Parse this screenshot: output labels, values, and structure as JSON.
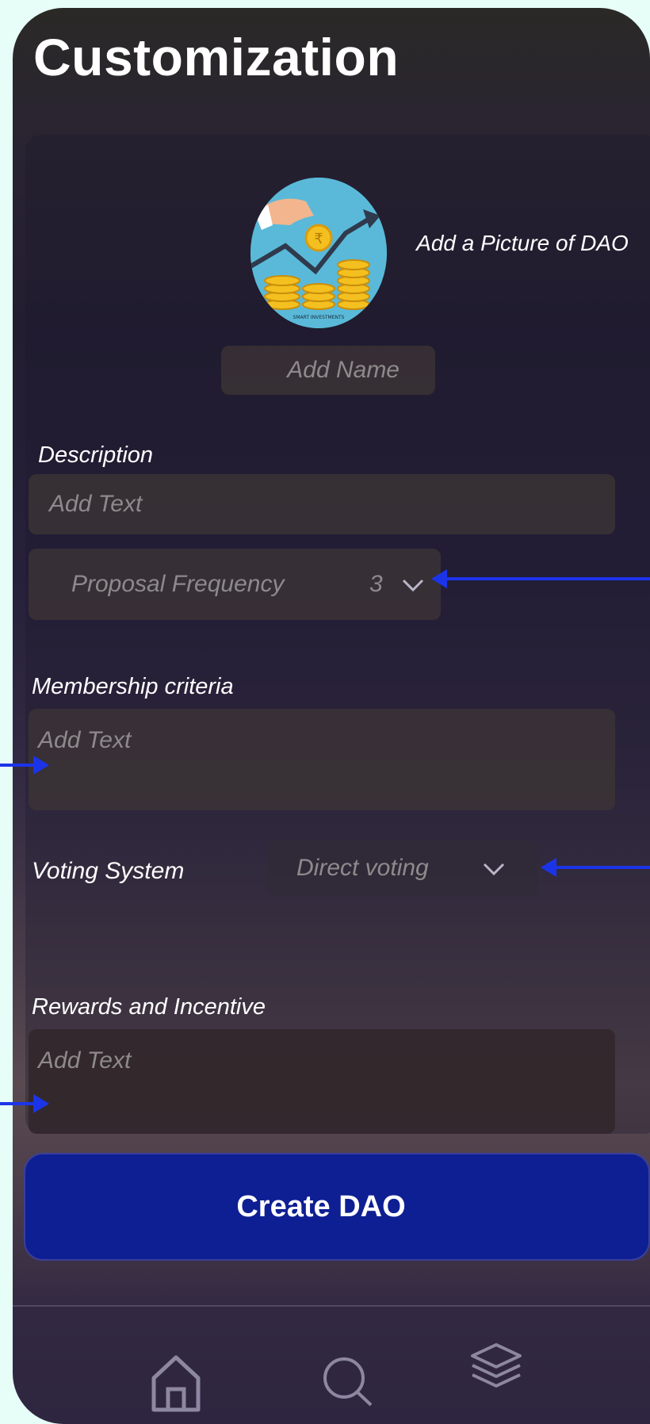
{
  "header": {
    "title": "Customization"
  },
  "picture": {
    "label": "Add a Picture of DAO",
    "avatar_caption": "SMART INVESTMENTS"
  },
  "name_field": {
    "placeholder": "Add Name"
  },
  "description": {
    "label": "Description",
    "placeholder": "Add Text"
  },
  "proposal_frequency": {
    "label": "Proposal Frequency",
    "value": "3"
  },
  "membership": {
    "label": "Membership criteria",
    "placeholder": "Add Text"
  },
  "voting": {
    "label": "Voting System",
    "value": "Direct voting"
  },
  "rewards": {
    "label": "Rewards and Incentive",
    "placeholder": "Add Text"
  },
  "create_button": {
    "label": "Create DAO"
  },
  "nav": {
    "items": [
      "home-icon",
      "search-icon",
      "layers-icon"
    ]
  },
  "colors": {
    "background": "#e6fdf8",
    "button": "#0e1f93",
    "annotation_arrow": "#1c34e8",
    "field": "#3e3636"
  }
}
